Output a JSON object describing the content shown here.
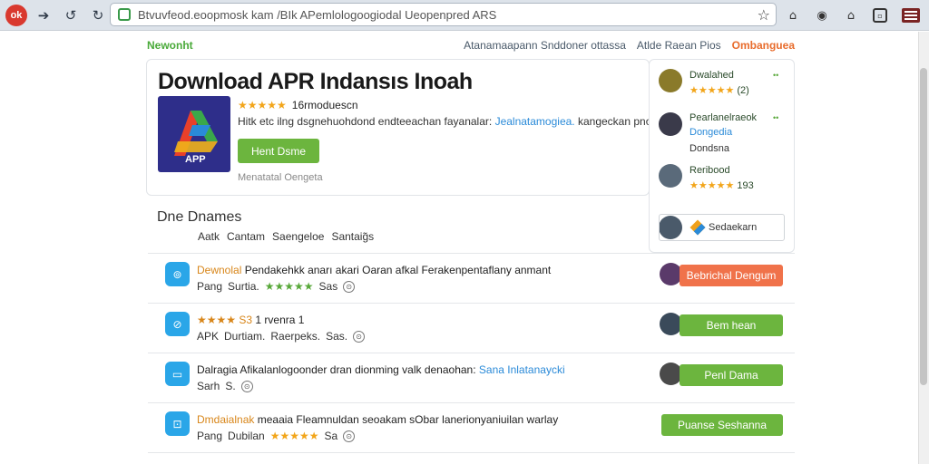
{
  "browser": {
    "url": "Btvuvfeod.eoopmosk kam /BIk APemlologoogiodal Ueopenpred ARS"
  },
  "topnav": {
    "brand": "Newonht",
    "brand_tag": "",
    "links": [
      "Atanamaapann Snddoner ottassa",
      "Atlde Raean Pios"
    ],
    "hot_link": "Ombanguea"
  },
  "hero": {
    "title": "Download APR Indansıs Inoah",
    "tile_label": "APP",
    "rating_text": "16rmoduescn",
    "description": "Hitk etc ilng dsgnehuohdond endteeachan fayanalar:",
    "description_link": "Jealnatamogiea.",
    "description_tail": "kangeckan pnomacel.",
    "primary_button": "Hent Dsme",
    "subtitle": "Menatatal Oengeta"
  },
  "sidebar": {
    "users": [
      {
        "name": "Dwalahed",
        "detail": "(2)",
        "stars": "★★★★★"
      },
      {
        "name": "Pearlanelraeok",
        "detail": "Dongedia",
        "extra": "Dondsna"
      },
      {
        "name": "Reribood",
        "detail": "193",
        "stars": "★★★★★"
      }
    ],
    "search_label": "Sedaekarn"
  },
  "section": {
    "title": "Dne Dnames",
    "filters": [
      "Aatk",
      "Cantam",
      "Saengeloe",
      "Santaig̃s"
    ]
  },
  "rows": [
    {
      "title_hl": "Dewnolal",
      "title": "Pendakehkk anarı akari Oaran afkal Ferakenpentaflany anmant",
      "meta": [
        "Pang",
        "Surtia."
      ],
      "stars": "★★★★★",
      "meta_tail": "Sas",
      "button": "Bebrichal Dengum",
      "button_color": "#f0724a"
    },
    {
      "title_hl": "★★★★ S3",
      "title": "1 rvenra 1",
      "meta": [
        "APK",
        "Durtiam.",
        "Raerpeks."
      ],
      "meta_tail": "Sas.",
      "button": "Bem hean",
      "button_color": "#6cb53e"
    },
    {
      "title": "Dalragia Afikalanlogoonder dran dionming valk denaohan:",
      "title_link": "Sana Inlatanaycki",
      "meta": [
        "Sarh",
        "S."
      ],
      "button": "Penl Dama",
      "button_color": "#6cb53e"
    },
    {
      "title_hl": "Dmdaialnak",
      "title": "meaaia Fleamnuldan seoakam sObar lanerionyaniuilan warlay",
      "meta": [
        "Pang",
        "Dubilan"
      ],
      "stars": "★★★★★",
      "meta_tail": "Sa",
      "button": "Puanse Seshanna",
      "button_color": "#6cb53e"
    }
  ]
}
